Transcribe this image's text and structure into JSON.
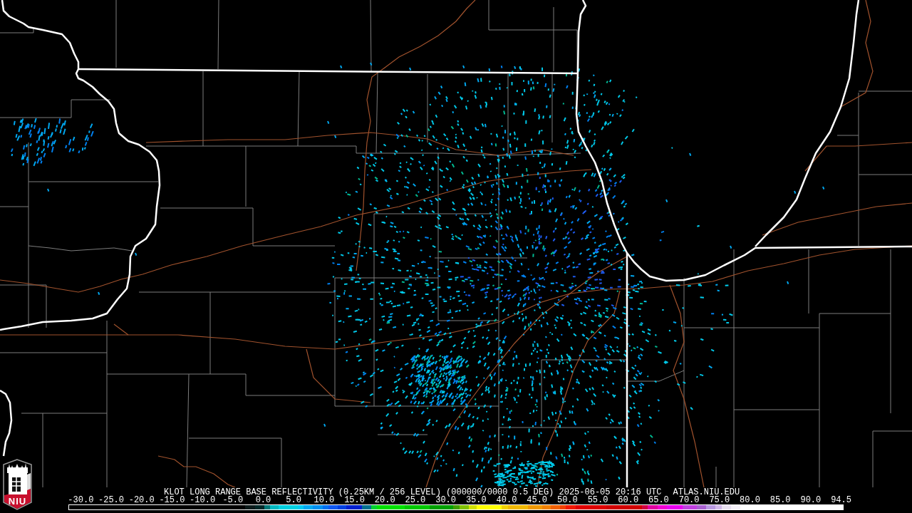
{
  "logo": {
    "text": "NIU"
  },
  "legend": {
    "title": "KLOT LONG RANGE BASE REFLECTIVITY (0.25KM / 256 LEVEL) (000000/0000 0.5 DEG) 2025-06-05 20:16 UTC",
    "source": "ATLAS.NIU.EDU",
    "scale_labels": [
      "-30.0",
      "-25.0",
      "-20.0",
      "-15.0",
      "-10.0",
      "-5.0",
      "0.0",
      "5.0",
      "10.0",
      "15.0",
      "20.0",
      "25.0",
      "30.0",
      "35.0",
      "40.0",
      "45.0",
      "50.0",
      "55.0",
      "60.0",
      "65.0",
      "70.0",
      "75.0",
      "80.0",
      "85.0",
      "90.0",
      "94.5"
    ]
  }
}
